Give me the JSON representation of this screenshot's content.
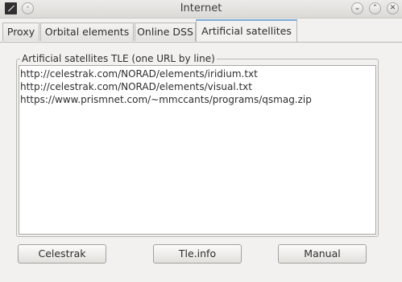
{
  "window": {
    "title": "Internet",
    "controls": {
      "minimize": "⌄",
      "maximize": "⌃",
      "close": "✕"
    }
  },
  "tabs": [
    {
      "label": "Proxy",
      "active": false
    },
    {
      "label": "Orbital elements",
      "active": false
    },
    {
      "label": "Online DSS",
      "active": false
    },
    {
      "label": "Artificial satellites",
      "active": true
    }
  ],
  "satellites": {
    "group_label": "Artificial satellites TLE (one URL by line)",
    "urls": [
      "http://celestrak.com/NORAD/elements/iridium.txt",
      "http://celestrak.com/NORAD/elements/visual.txt",
      "https://www.prismnet.com/~mmccants/programs/qsmag.zip"
    ],
    "buttons": {
      "celestrak": "Celestrak",
      "tleinfo": "Tle.info",
      "manual": "Manual"
    }
  }
}
